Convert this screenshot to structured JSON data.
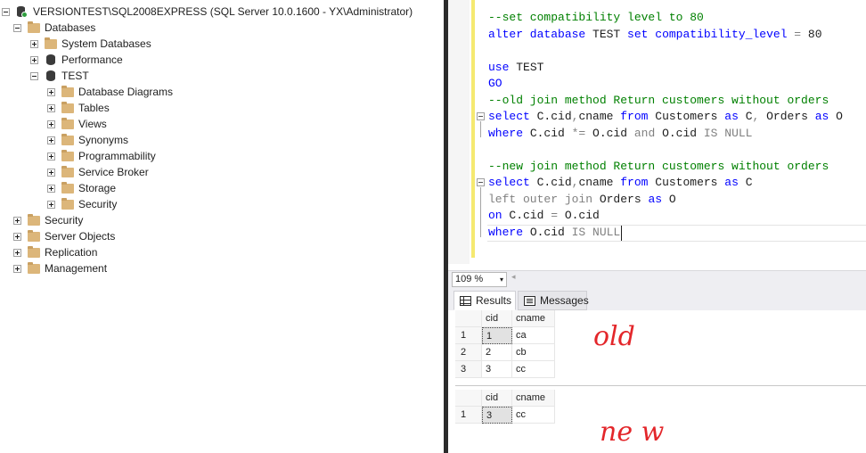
{
  "explorer": {
    "server": "VERSIONTEST\\SQL2008EXPRESS (SQL Server 10.0.1600 - YX\\Administrator)",
    "databases": "Databases",
    "system_databases": "System Databases",
    "performance": "Performance",
    "test": "TEST",
    "test_children": [
      "Database Diagrams",
      "Tables",
      "Views",
      "Synonyms",
      "Programmability",
      "Service Broker",
      "Storage",
      "Security"
    ],
    "security": "Security",
    "server_objects": "Server Objects",
    "replication": "Replication",
    "management": "Management"
  },
  "editor": {
    "lines": [
      [
        {
          "t": "--set compatibility level to 80",
          "c": "comment"
        }
      ],
      [
        {
          "t": "alter database ",
          "c": "kw"
        },
        {
          "t": "TEST ",
          "c": "plain"
        },
        {
          "t": "set ",
          "c": "kw"
        },
        {
          "t": "compatibility_level ",
          "c": "kw"
        },
        {
          "t": "= ",
          "c": "gray"
        },
        {
          "t": "80",
          "c": "plain"
        }
      ],
      [],
      [
        {
          "t": "use ",
          "c": "kw"
        },
        {
          "t": "TEST",
          "c": "plain"
        }
      ],
      [
        {
          "t": "GO",
          "c": "kw"
        }
      ],
      [
        {
          "t": "--old join method Return customers without orders",
          "c": "comment"
        }
      ],
      [
        {
          "t": "select ",
          "c": "kw"
        },
        {
          "t": "C.cid",
          "c": "plain"
        },
        {
          "t": ",",
          "c": "gray"
        },
        {
          "t": "cname ",
          "c": "plain"
        },
        {
          "t": "from ",
          "c": "kw"
        },
        {
          "t": "Customers ",
          "c": "plain"
        },
        {
          "t": "as ",
          "c": "kw"
        },
        {
          "t": "C",
          "c": "plain"
        },
        {
          "t": ", ",
          "c": "gray"
        },
        {
          "t": "Orders ",
          "c": "plain"
        },
        {
          "t": "as ",
          "c": "kw"
        },
        {
          "t": "O",
          "c": "plain"
        }
      ],
      [
        {
          "t": "where ",
          "c": "kw"
        },
        {
          "t": "C.cid ",
          "c": "plain"
        },
        {
          "t": "*= ",
          "c": "gray"
        },
        {
          "t": "O.cid ",
          "c": "plain"
        },
        {
          "t": "and ",
          "c": "gray"
        },
        {
          "t": "O.cid ",
          "c": "plain"
        },
        {
          "t": "IS NULL",
          "c": "gray"
        }
      ],
      [],
      [
        {
          "t": "--new join method Return customers without orders",
          "c": "comment"
        }
      ],
      [
        {
          "t": "select ",
          "c": "kw"
        },
        {
          "t": "C.cid",
          "c": "plain"
        },
        {
          "t": ",",
          "c": "gray"
        },
        {
          "t": "cname ",
          "c": "plain"
        },
        {
          "t": "from ",
          "c": "kw"
        },
        {
          "t": "Customers ",
          "c": "plain"
        },
        {
          "t": "as ",
          "c": "kw"
        },
        {
          "t": "C",
          "c": "plain"
        }
      ],
      [
        {
          "t": "left outer join ",
          "c": "gray"
        },
        {
          "t": "Orders ",
          "c": "plain"
        },
        {
          "t": "as ",
          "c": "kw"
        },
        {
          "t": "O",
          "c": "plain"
        }
      ],
      [
        {
          "t": "on ",
          "c": "kw"
        },
        {
          "t": "C.cid ",
          "c": "plain"
        },
        {
          "t": "= ",
          "c": "gray"
        },
        {
          "t": "O.cid",
          "c": "plain"
        }
      ],
      [
        {
          "t": "where ",
          "c": "kw"
        },
        {
          "t": "O.cid ",
          "c": "plain"
        },
        {
          "t": "IS NULL",
          "c": "gray"
        }
      ]
    ]
  },
  "zoom": {
    "level": "109 %",
    "arrow": "▾",
    "scroll_left": "◂"
  },
  "tabs": {
    "results": "Results",
    "messages": "Messages"
  },
  "grid_old": {
    "columns": [
      "cid",
      "cname"
    ],
    "rows": [
      {
        "num": "1",
        "cid": "1",
        "cname": "ca"
      },
      {
        "num": "2",
        "cid": "2",
        "cname": "cb"
      },
      {
        "num": "3",
        "cid": "3",
        "cname": "cc"
      }
    ]
  },
  "grid_new": {
    "columns": [
      "cid",
      "cname"
    ],
    "rows": [
      {
        "num": "1",
        "cid": "3",
        "cname": "cc"
      }
    ]
  },
  "annotations": {
    "old": "old",
    "new": "ne w",
    "color": "#e3262a"
  }
}
